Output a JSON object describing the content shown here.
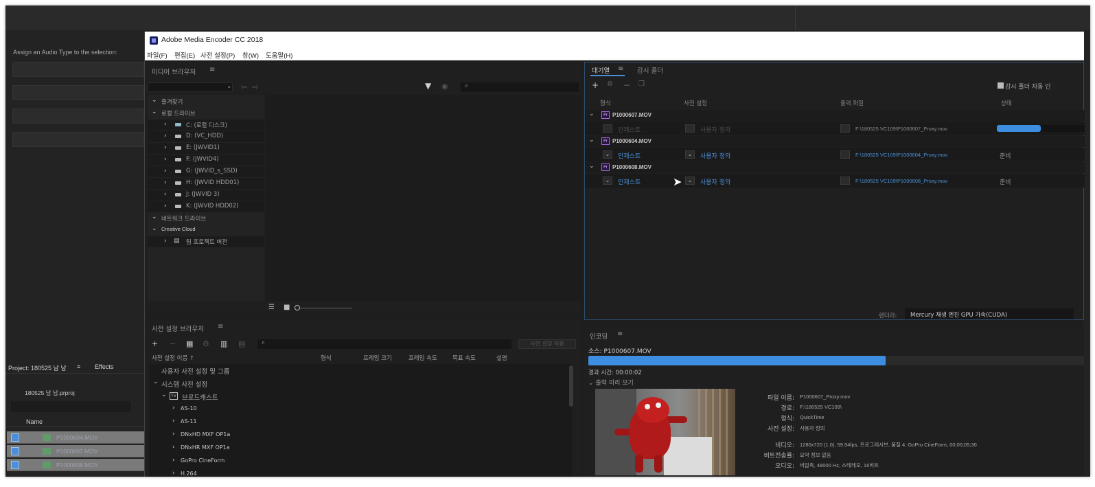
{
  "premiere": {
    "assign_label": "Assign an Audio Type to the selection:",
    "project_tab": "Project: 180525 남 남",
    "effects_tab": "Effects",
    "project_file": "180525 남 남.prproj",
    "name_header": "Name",
    "clips": [
      "P1000604.MOV",
      "P1000607.MOV",
      "P1000608.MOV"
    ]
  },
  "window": {
    "title": "Adobe Media Encoder CC 2018",
    "menu": [
      "파일(F)",
      "편집(E)",
      "사전 설정(P)",
      "창(W)",
      "도움말(H)"
    ]
  },
  "media_browser": {
    "title": "미디어 브라우저",
    "tree": [
      {
        "label": "즐겨찾기",
        "type": "section"
      },
      {
        "label": "로컬 드라이브",
        "type": "section"
      },
      {
        "label": "C: (로컬 디스크)",
        "type": "drive",
        "system": true
      },
      {
        "label": "D: (VC_HDD)",
        "type": "drive"
      },
      {
        "label": "E: (JWVID1)",
        "type": "drive"
      },
      {
        "label": "F: (JWVID4)",
        "type": "drive"
      },
      {
        "label": "G: (JWVID_s_SSD)",
        "type": "drive"
      },
      {
        "label": "H: (JWVID HDD01)",
        "type": "drive"
      },
      {
        "label": "J: (JWVID 3)",
        "type": "drive"
      },
      {
        "label": "K: (JWVID HDD02)",
        "type": "drive"
      },
      {
        "label": "네트워크 드라이브",
        "type": "section"
      },
      {
        "label": "Creative Cloud",
        "type": "section-small"
      },
      {
        "label": "팀 프로젝트 버전",
        "type": "team"
      }
    ]
  },
  "preset_browser": {
    "title": "사전 설정 브라우저",
    "apply_label": "사전 설정 적용",
    "columns": [
      "사전 설정 이름 ↑",
      "형식",
      "프레임 크기",
      "프레임 속도",
      "목표 속도",
      "설명"
    ],
    "rows": [
      {
        "label": "사용자 사전 설정 및 그룹",
        "level": 0,
        "chev": false
      },
      {
        "label": "시스템 사전 설정",
        "level": 0,
        "chev": true
      },
      {
        "label": "브로드캐스트",
        "level": 1,
        "chev": true
      },
      {
        "label": "AS-10",
        "level": 2,
        "chev": true
      },
      {
        "label": "AS-11",
        "level": 2,
        "chev": true
      },
      {
        "label": "DNxHD MXF OP1a",
        "level": 2,
        "chev": true
      },
      {
        "label": "DNxHR MXF OP1a",
        "level": 2,
        "chev": true
      },
      {
        "label": "GoPro CineForm",
        "level": 2,
        "chev": true
      },
      {
        "label": "H.264",
        "level": 2,
        "chev": true
      }
    ]
  },
  "queue": {
    "tab_queue": "대기열",
    "tab_watch": "감시 폴더",
    "auto_label": "감시 폴더 자동 인",
    "columns": [
      "형식",
      "사전 설정",
      "출력 파일",
      "상태"
    ],
    "groups": [
      {
        "file": "P1000607.MOV",
        "format": "인제스트",
        "preset": "사용자 정의",
        "output": "F:\\180525 VC109\\P1000607_Proxy.mov",
        "status": "",
        "progress": 0.5,
        "active": false
      },
      {
        "file": "P1000604.MOV",
        "format": "인제스트",
        "preset": "사용자 정의",
        "output": "F:\\180525 VC109\\P1000604_Proxy.mov",
        "status": "준비",
        "progress": 0,
        "active": true
      },
      {
        "file": "P1000608.MOV",
        "format": "인제스트",
        "preset": "사용자 정의",
        "output": "F:\\180525 VC109\\P1000608_Proxy.mov",
        "status": "준비",
        "progress": 0,
        "active": true
      }
    ],
    "renderer_label": "렌더러:",
    "renderer_value": "Mercury 재생 엔진 GPU 가속(CUDA)"
  },
  "encoding": {
    "title": "인코딩",
    "source": "소스: P1000607.MOV",
    "progress": 0.6,
    "elapsed": "경과 시간: 00:00:02",
    "preview_label": "출력 미리 보기",
    "info": [
      {
        "k": "파일 이름:",
        "v": "P1000607_Proxy.mov"
      },
      {
        "k": "경로:",
        "v": "F:\\180525 VC109\\"
      },
      {
        "k": "형식:",
        "v": "QuickTime"
      },
      {
        "k": "사전 설정:",
        "v": "사용자 정의"
      },
      {
        "k": "비디오:",
        "v": "1280x720 (1.0), 59.94fps, 프로그레시브, 품질 4, GoPro CineForm, 00;00;05;30"
      },
      {
        "k": "비트전송률:",
        "v": "요약 정보 없음"
      },
      {
        "k": "오디오:",
        "v": "비압축, 48000 Hz, 스테레오, 16비트"
      }
    ]
  },
  "colors": {
    "accent": "#3d8ee0",
    "link": "#4a90d9",
    "premiere_purple": "#9c6fd1"
  }
}
